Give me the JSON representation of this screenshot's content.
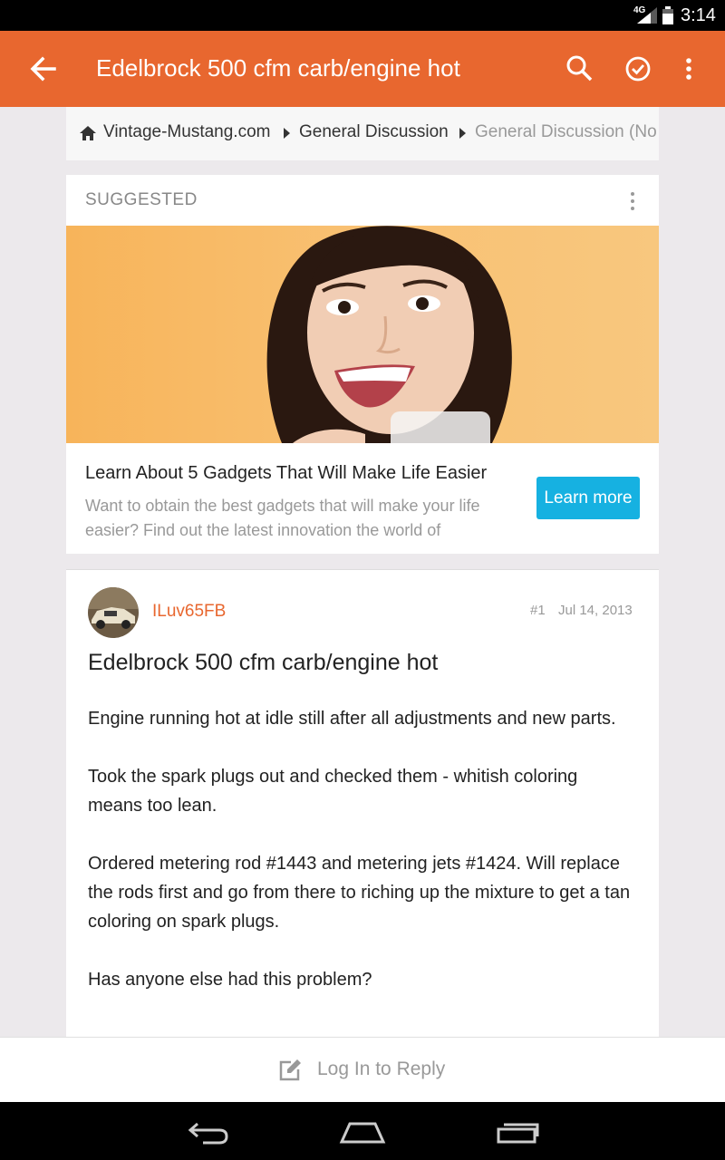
{
  "status_bar": {
    "network": "4G",
    "time": "3:14"
  },
  "app_bar": {
    "title": "Edelbrock 500 cfm carb/engine hot"
  },
  "breadcrumb": {
    "items": [
      "Vintage-Mustang.com",
      "General Discussion",
      "General Discussion (No"
    ]
  },
  "ad": {
    "label": "SUGGESTED",
    "headline": "Learn About 5 Gadgets That Will Make Life Easier",
    "description": "Want to obtain the best gadgets that will make your life easier? Find out the latest innovation the world of",
    "cta": "Learn more",
    "cta_color": "#16b1e1"
  },
  "post": {
    "author": "ILuv65FB",
    "number": "#1",
    "date": "Jul 14, 2013",
    "title": "Edelbrock 500 cfm carb/engine hot",
    "paragraphs": [
      "Engine running hot at idle still after all adjustments and new parts.",
      "Took the spark plugs out and checked them - whitish coloring means too lean.",
      "Ordered metering rod #1443 and metering jets #1424. Will replace the rods first and go from there to riching up the mixture to get a tan coloring on spark plugs.",
      "Has anyone else had this problem?"
    ]
  },
  "reply_bar": {
    "label": "Log In to Reply"
  },
  "colors": {
    "accent": "#e8672f",
    "background": "#ece9ec"
  },
  "icons": [
    "back-arrow-icon",
    "search-icon",
    "check-circle-icon",
    "overflow-menu-icon",
    "home-icon",
    "edit-icon",
    "nav-back-icon",
    "nav-home-icon",
    "nav-recents-icon"
  ]
}
